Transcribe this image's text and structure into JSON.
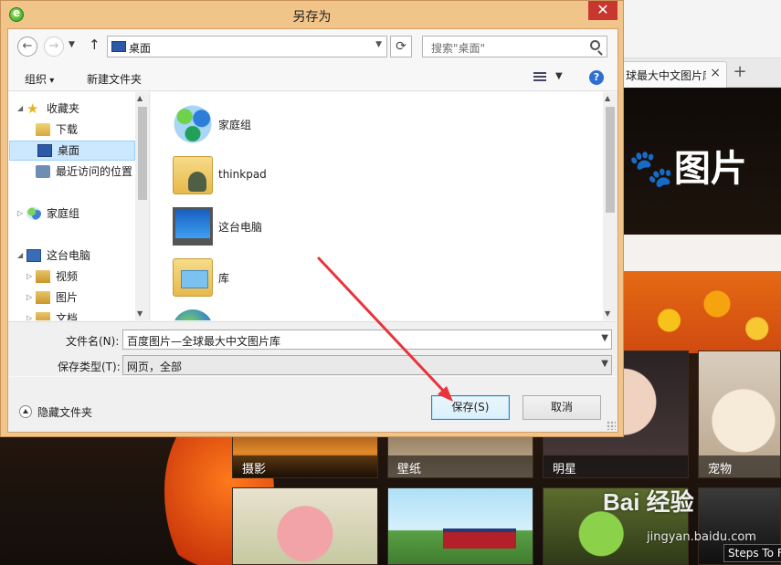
{
  "browser": {
    "tab_title": "球最大中文图片库",
    "tab_close": "×",
    "new_tab": "+",
    "logo_text": "图片"
  },
  "page": {
    "tiles": [
      {
        "label": "摄影"
      },
      {
        "label": "壁纸"
      },
      {
        "label": "明星"
      },
      {
        "label": "宠物"
      }
    ],
    "watermark_logo": "Bai 经验",
    "watermark_url": "jingyan.baidu.com",
    "steps_badge": "Steps To F"
  },
  "dialog": {
    "title": "另存为",
    "close_glyph": "✕",
    "address": {
      "location": "桌面",
      "search_placeholder": "搜索\"桌面\""
    },
    "toolbar": {
      "organize": "组织",
      "new_folder": "新建文件夹",
      "help": "?"
    },
    "nav": {
      "items": [
        {
          "label": "收藏夹"
        },
        {
          "label": "下载"
        },
        {
          "label": "桌面"
        },
        {
          "label": "最近访问的位置"
        },
        {
          "label": "家庭组"
        },
        {
          "label": "这台电脑"
        },
        {
          "label": "视频"
        },
        {
          "label": "图片"
        },
        {
          "label": "文档"
        }
      ]
    },
    "files": [
      {
        "name": "家庭组",
        "icon": "homegroup-icon"
      },
      {
        "name": "thinkpad",
        "icon": "user-folder-icon"
      },
      {
        "name": "这台电脑",
        "icon": "computer-icon"
      },
      {
        "name": "库",
        "icon": "library-icon"
      }
    ],
    "fields": {
      "filename_label": "文件名(N):",
      "filename_value": "百度图片—全球最大中文图片库",
      "filetype_label": "保存类型(T):",
      "filetype_value": "网页，全部"
    },
    "footer": {
      "hide_folders": "隐藏文件夹",
      "save": "保存(S)",
      "cancel": "取消"
    }
  },
  "colors": {
    "dialog_frame": "#f1c58a",
    "close_button": "#c7372f",
    "selection": "#cce8ff",
    "annotation_arrow": "#e8343a"
  }
}
